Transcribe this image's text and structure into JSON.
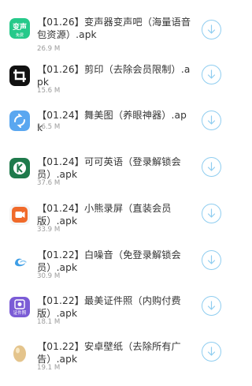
{
  "colors": {
    "download_accent": "#8fcdf0",
    "title_text": "#333333",
    "size_text": "#9b9b9b"
  },
  "apps": [
    {
      "title": "【01.26】变声器变声吧（海量语音包资源）.apk",
      "size": "26.9 M",
      "icon": "voice-changer-icon",
      "icon_text": "变声",
      "icon_subtext": "免费"
    },
    {
      "title": "【01.26】剪印（去除会员限制）.apk",
      "size": "15.6 M",
      "icon": "video-editor-icon"
    },
    {
      "title": "【01.24】舞美图（养眼神器）.apk",
      "size": "16.5 M",
      "icon": "photo-app-icon"
    },
    {
      "title": "【01.24】可可英语（登录解锁会员）.apk",
      "size": "37.6 M",
      "icon": "english-app-icon"
    },
    {
      "title": "【01.24】小熊录屏（直装会员版）.apk",
      "size": "33.9 M",
      "icon": "screen-recorder-icon"
    },
    {
      "title": "【01.22】白噪音（免登录解锁会员）.apk",
      "size": "30.9 M",
      "icon": "white-noise-icon"
    },
    {
      "title": "【01.22】最美证件照（内购付费版）.apk",
      "size": "18.1 M",
      "icon": "id-photo-icon",
      "icon_text": "证件照"
    },
    {
      "title": "【01.22】安卓壁纸（去除所有广告）.apk",
      "size": "19.1 M",
      "icon": "wallpaper-egg-icon"
    }
  ]
}
